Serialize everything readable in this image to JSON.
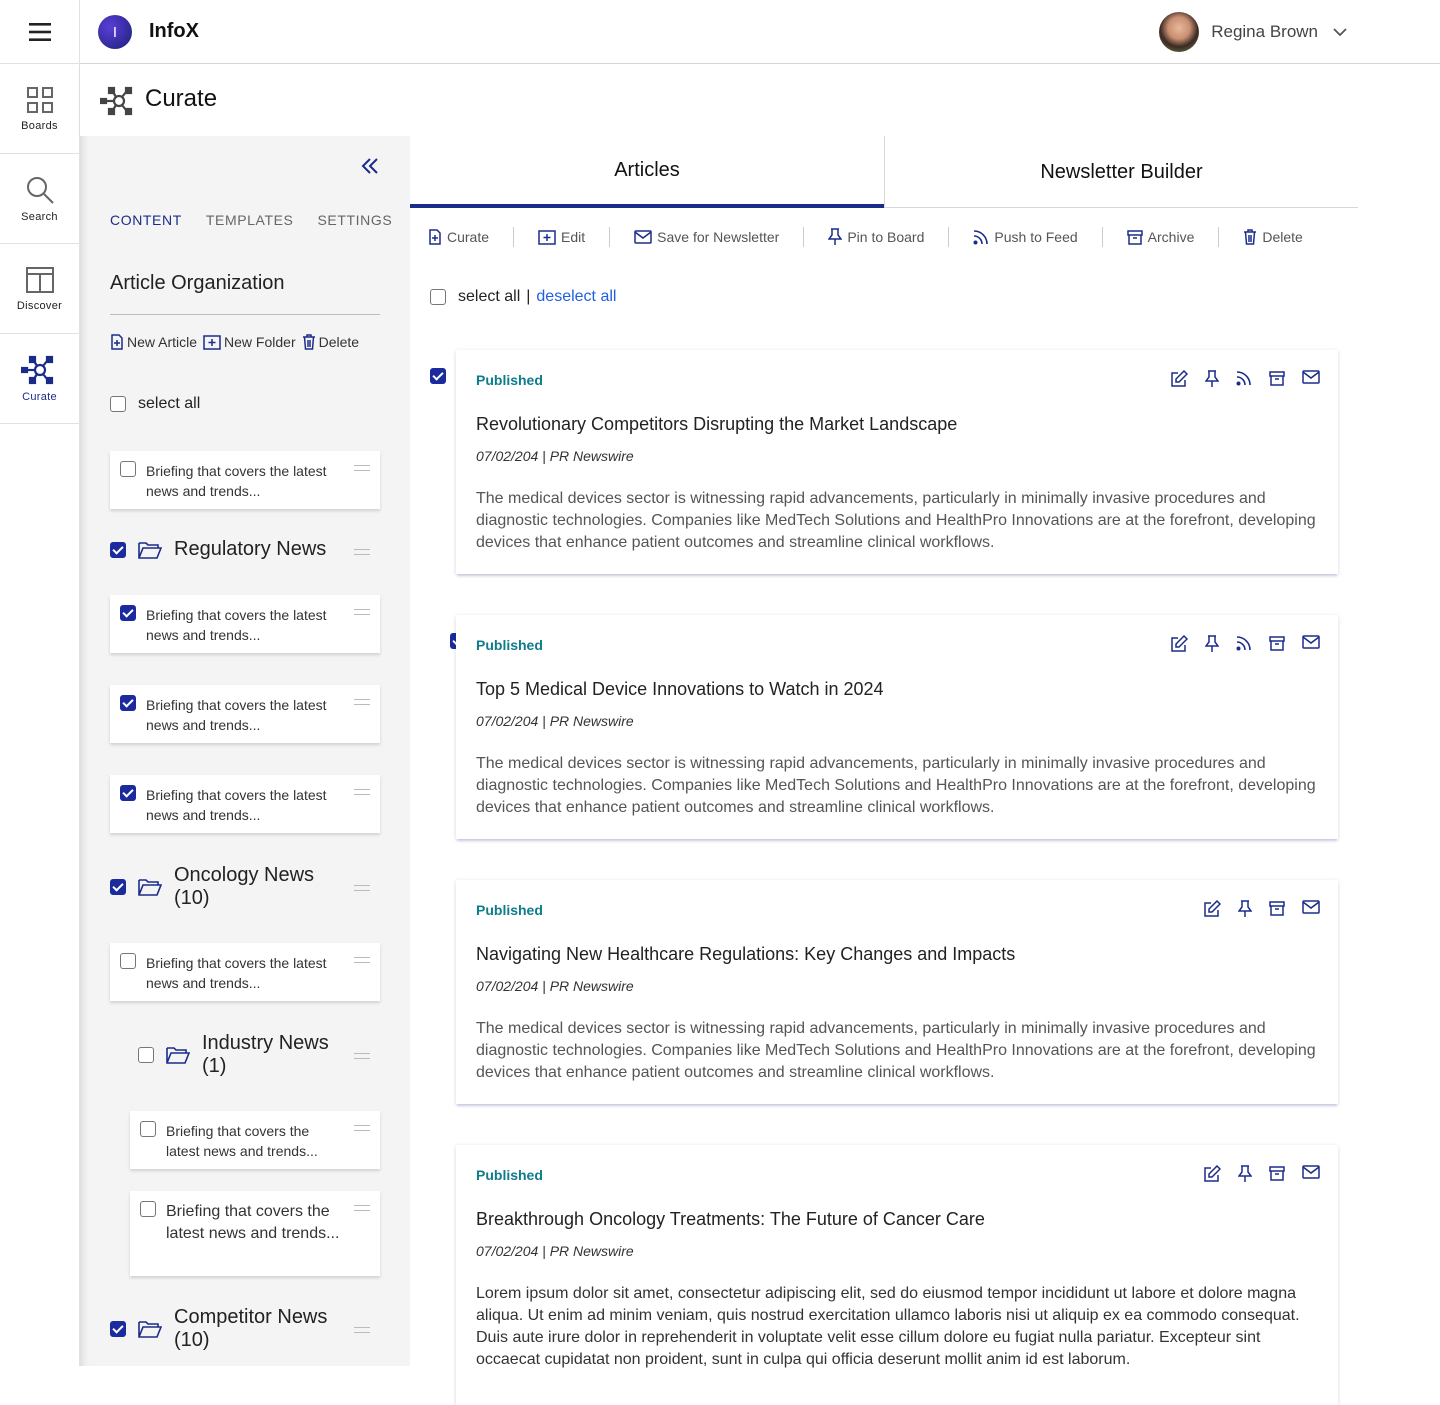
{
  "app": {
    "title": "InfoX",
    "logo_letter": "I"
  },
  "user": {
    "name": "Regina Brown"
  },
  "nav": [
    {
      "label": "Boards",
      "icon": "grid-icon"
    },
    {
      "label": "Search",
      "icon": "search-icon"
    },
    {
      "label": "Discover",
      "icon": "layout-icon"
    },
    {
      "label": "Curate",
      "icon": "network-icon",
      "active": true
    }
  ],
  "page": {
    "title": "Curate"
  },
  "sidebar": {
    "tabs": [
      "CONTENT",
      "TEMPLATES",
      "SETTINGS"
    ],
    "section_title": "Article Organization",
    "actions": {
      "new_article": "New Article",
      "new_folder": "New Folder",
      "delete": "Delete"
    },
    "select_all": "select all",
    "briefing": "Briefing that covers the latest news and trends...",
    "folders": {
      "regulatory": "Regulatory News",
      "oncology": "Oncology News (10)",
      "industry": "Industry News (1)",
      "competitor": "Competitor News (10)"
    }
  },
  "main": {
    "tabs": [
      "Articles",
      "Newsletter Builder"
    ],
    "toolbar": {
      "curate": "Curate",
      "edit": "Edit",
      "save": "Save for Newsletter",
      "pin": "Pin to Board",
      "push": "Push to Feed",
      "archive": "Archive",
      "delete": "Delete"
    },
    "select_all": "select all",
    "separator": "|",
    "deselect_all": "deselect all",
    "articles": [
      {
        "status": "Published",
        "title": "Revolutionary Competitors Disrupting the Market Landscape",
        "meta": "07/02/204 | PR Newswire",
        "body": "The medical devices sector is witnessing rapid advancements, particularly in minimally invasive procedures and diagnostic technologies. Companies like MedTech Solutions and HealthPro Innovations are at the forefront, developing devices that enhance patient outcomes and streamline clinical workflows."
      },
      {
        "status": "Published",
        "title": "Top 5 Medical Device Innovations to Watch in 2024",
        "meta": "07/02/204 | PR Newswire",
        "body": "The medical devices sector is witnessing rapid advancements, particularly in minimally invasive procedures and diagnostic technologies. Companies like MedTech Solutions and HealthPro Innovations are at the forefront, developing devices that enhance patient outcomes and streamline clinical workflows."
      },
      {
        "status": "Published",
        "title": "Navigating New Healthcare Regulations: Key Changes and Impacts",
        "meta": "07/02/204 | PR Newswire",
        "body": "The medical devices sector is witnessing rapid advancements, particularly in minimally invasive procedures and diagnostic technologies. Companies like MedTech Solutions and HealthPro Innovations are at the forefront, developing devices that enhance patient outcomes and streamline clinical workflows."
      },
      {
        "status": "Published",
        "title": "Breakthrough Oncology Treatments: The Future of Cancer Care",
        "meta": "07/02/204 | PR Newswire",
        "body": "Lorem ipsum dolor sit amet, consectetur adipiscing elit, sed do eiusmod tempor incididunt ut labore et dolore magna aliqua. Ut enim ad minim veniam, quis nostrud exercitation ullamco laboris nisi ut aliquip ex ea commodo consequat. Duis aute irure dolor in reprehenderit in voluptate velit esse cillum dolore eu fugiat nulla pariatur. Excepteur sint occaecat cupidatat non proident, sunt in culpa qui officia deserunt mollit anim id est laborum."
      }
    ]
  },
  "colors": {
    "accent": "#1b2b8a",
    "status": "#0e7c8a",
    "link": "#1f5fe0"
  }
}
